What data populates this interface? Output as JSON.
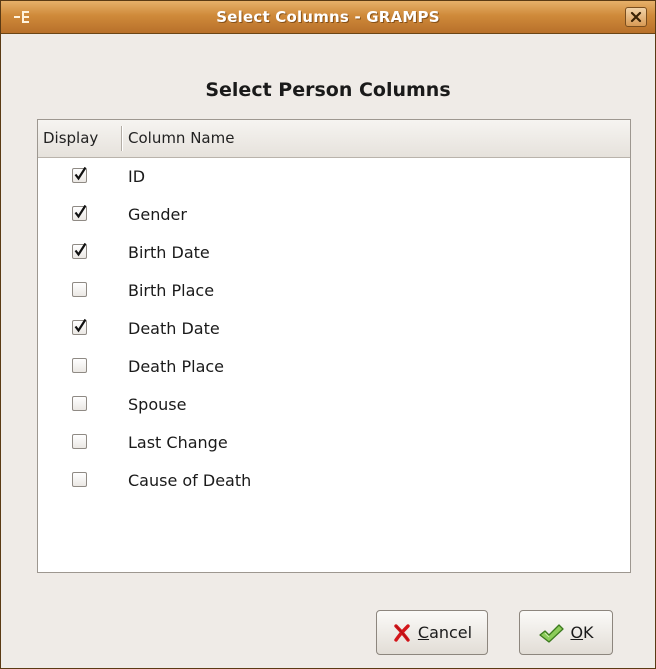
{
  "window": {
    "title": "Select Columns - GRAMPS"
  },
  "dialog": {
    "heading": "Select Person Columns"
  },
  "list": {
    "headers": {
      "display": "Display",
      "column_name": "Column Name"
    },
    "rows": [
      {
        "label": "ID",
        "checked": true
      },
      {
        "label": "Gender",
        "checked": true
      },
      {
        "label": "Birth Date",
        "checked": true
      },
      {
        "label": "Birth Place",
        "checked": false
      },
      {
        "label": "Death Date",
        "checked": true
      },
      {
        "label": "Death Place",
        "checked": false
      },
      {
        "label": "Spouse",
        "checked": false
      },
      {
        "label": "Last Change",
        "checked": false
      },
      {
        "label": "Cause of Death",
        "checked": false
      }
    ]
  },
  "buttons": {
    "cancel": {
      "label_first": "C",
      "label_rest": "ancel",
      "icon": "red-x-icon"
    },
    "ok": {
      "label_first": "O",
      "label_rest": "K",
      "icon": "green-check-icon"
    }
  },
  "colors": {
    "titlebar": "#cf8a3a",
    "window_bg": "#efebe7",
    "cancel_icon": "#d4161b",
    "ok_icon": "#5fa832"
  }
}
